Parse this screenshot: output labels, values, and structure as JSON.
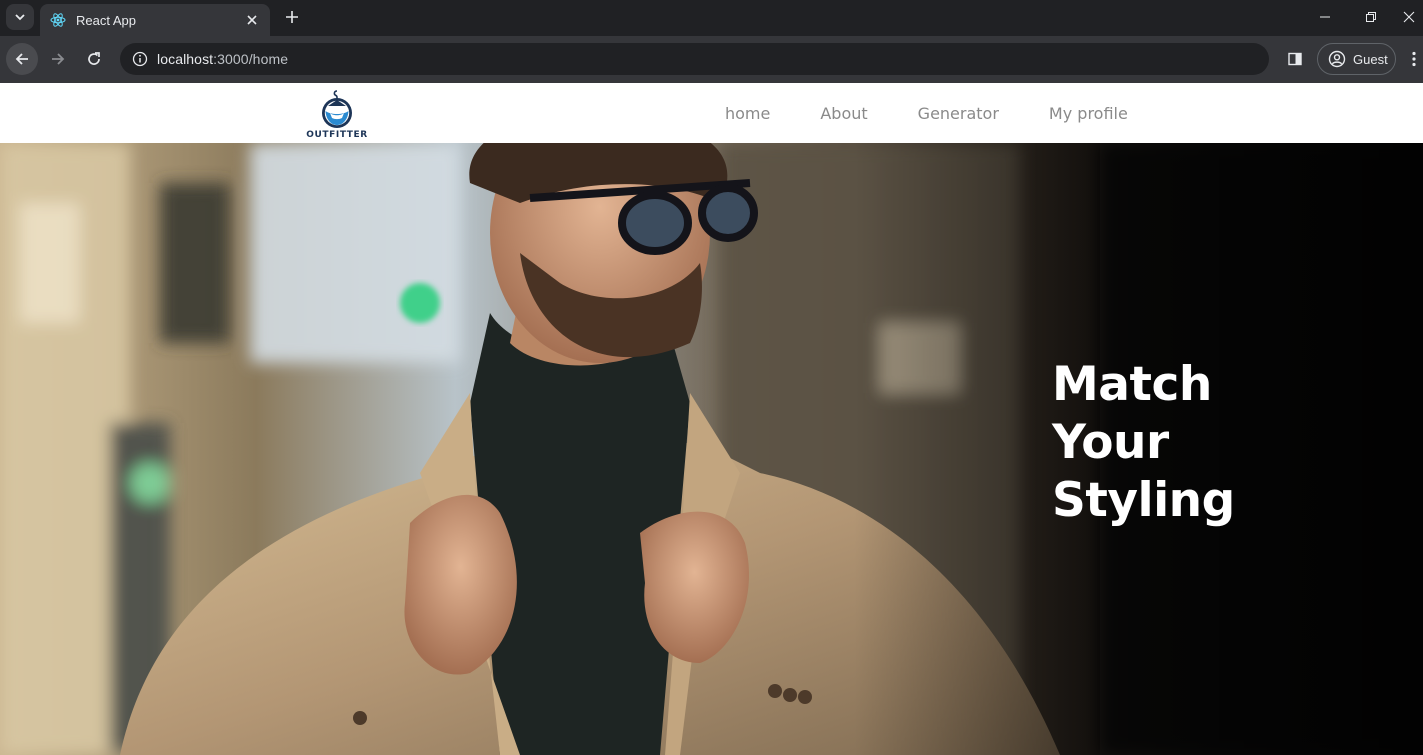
{
  "browser": {
    "tab": {
      "title": "React App",
      "favicon": "react-icon"
    },
    "address": {
      "host": "localhost",
      "path": ":3000/home"
    },
    "profile": {
      "label": "Guest"
    }
  },
  "site": {
    "logo": {
      "text": "OUTFITTER",
      "icon": "hanger-icon"
    },
    "nav": [
      {
        "label": "home"
      },
      {
        "label": "About"
      },
      {
        "label": "Generator"
      },
      {
        "label": "My profile"
      }
    ],
    "hero": {
      "title_lines": [
        "Match",
        "Your",
        "Styling"
      ],
      "image": "man-in-coat-photo"
    }
  },
  "colors": {
    "chrome_dark": "#202124",
    "chrome_toolbar": "#35363a",
    "nav_text": "#8a8a8a",
    "logo_navy": "#1d3557",
    "logo_blue": "#2b8bd1",
    "hero_text": "#ffffff"
  }
}
